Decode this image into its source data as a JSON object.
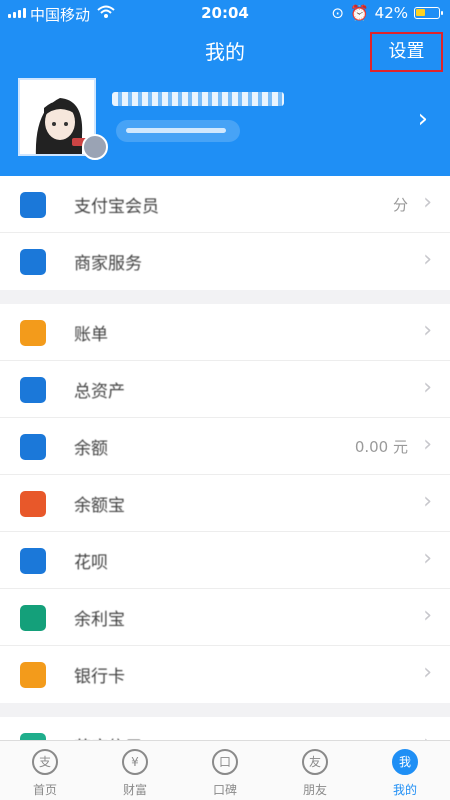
{
  "status_bar": {
    "carrier": "中国移动",
    "time": "20:04",
    "battery": "42%",
    "battery_level": 0.42
  },
  "header": {
    "title": "我的",
    "settings_label": "设置"
  },
  "menu": [
    {
      "label": "支付宝会员",
      "value": "分",
      "color": "#1b78d9"
    },
    {
      "label": "商家服务",
      "value": "",
      "color": "#1b78d9"
    },
    {
      "label": "账单",
      "value": "",
      "color": "#f39b1b"
    },
    {
      "label": "总资产",
      "value": "",
      "color": "#1b78d9"
    },
    {
      "label": "余额",
      "value": "0.00 元",
      "color": "#1b78d9"
    },
    {
      "label": "余额宝",
      "value": "",
      "color": "#e8582a"
    },
    {
      "label": "花呗",
      "value": "",
      "color": "#1b78d9"
    },
    {
      "label": "余利宝",
      "value": "",
      "color": "#14a07a"
    },
    {
      "label": "银行卡",
      "value": "",
      "color": "#f39b1b"
    },
    {
      "label": "芝麻信用",
      "value": "",
      "color": "#1fae8c"
    }
  ],
  "tabs": [
    {
      "label": "首页",
      "glyph": "支"
    },
    {
      "label": "财富",
      "glyph": "¥"
    },
    {
      "label": "口碑",
      "glyph": "口"
    },
    {
      "label": "朋友",
      "glyph": "友"
    },
    {
      "label": "我的",
      "glyph": "我"
    }
  ]
}
